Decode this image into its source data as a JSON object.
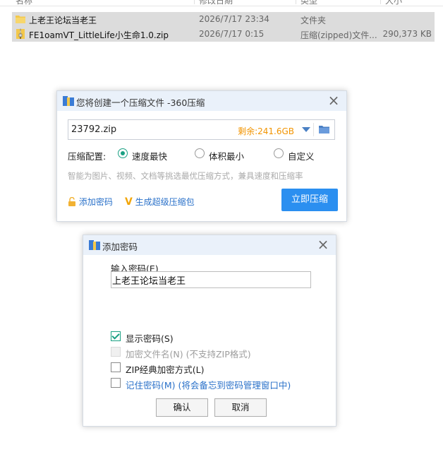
{
  "explorer": {
    "columns": [
      "名称",
      "修改日期",
      "类型",
      "大小"
    ],
    "files": [
      {
        "icon": "folder-icon",
        "name": "上老王论坛当老王",
        "date": "2026/7/17 23:34",
        "type": "文件夹",
        "size": ""
      },
      {
        "icon": "zip-file-icon",
        "name": "FE1oamVT_LittleLife小生命1.0.zip",
        "date": "2026/7/17 0:15",
        "type": "压缩(zipped)文件...",
        "size": "290,373 KB"
      }
    ]
  },
  "compress_dialog": {
    "title": "您将创建一个压缩文件 -360压缩",
    "filename": "23792.zip",
    "remaining": "剩余:241.6GB",
    "config_label": "压缩配置:",
    "options": [
      {
        "label": "速度最快",
        "selected": true
      },
      {
        "label": "体积最小",
        "selected": false
      },
      {
        "label": "自定义",
        "selected": false
      }
    ],
    "hint": "智能为图片、视频、文档等挑选最优压缩方式，兼具速度和压缩率",
    "add_password_link": "添加密码",
    "super_compress_link": "生成超级压缩包",
    "compress_button": "立即压缩",
    "accent_color": "#2b8ff0"
  },
  "password_dialog": {
    "title": "添加密码",
    "input_label": "输入密码(E)",
    "password_value": "上老王论坛当老王",
    "options": [
      {
        "label": "显示密码(S)",
        "checked": true,
        "disabled": false
      },
      {
        "label": "加密文件名(N) (不支持ZIP格式)",
        "checked": false,
        "disabled": true
      },
      {
        "label": "ZIP经典加密方式(L)",
        "checked": false,
        "disabled": false
      },
      {
        "label": "记住密码(M) (将会备忘到密码管理窗口中)",
        "checked": false,
        "disabled": false
      }
    ],
    "confirm_button": "确认",
    "cancel_button": "取消"
  }
}
